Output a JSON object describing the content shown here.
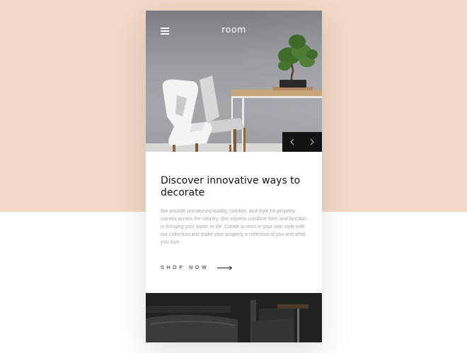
{
  "app": {
    "brand": "room"
  },
  "hero": {
    "menu_icon": "hamburger-menu-icon",
    "prev_icon": "chevron-left-icon",
    "next_icon": "chevron-right-icon"
  },
  "content": {
    "headline": "Discover innovative ways to decorate",
    "description": "We provide unmatched quality, comfort, and style for property owners across the country. Our experts combine form and function in bringing your vision to life. Create a room in your own style with our collection and make your property a reflection of you and what you love.",
    "cta_label": "SHOP NOW",
    "cta_icon": "arrow-right-icon"
  },
  "colors": {
    "background_top": "#f2d9c6",
    "background_bottom": "#ffffff",
    "card": "#ffffff",
    "headline": "#121212",
    "body_text": "#a6a6a6",
    "slider_nav": "#111214"
  }
}
